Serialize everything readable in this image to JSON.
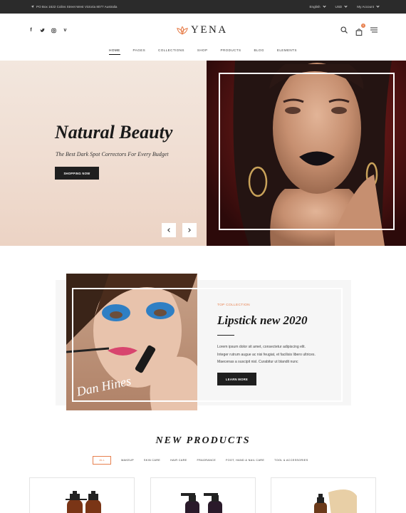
{
  "topbar": {
    "address": "PO Box 1622 Colins Street West Victoria 8077 Australia",
    "language": "English",
    "currency": "USD",
    "account": "My Account"
  },
  "header": {
    "logo": "YENA",
    "nav": [
      "HOME",
      "PAGES",
      "COLLECTIONS",
      "SHOP",
      "PRODUCTS",
      "BLOG",
      "ELEMENTS"
    ],
    "cart_count": "0"
  },
  "hero": {
    "title": "Natural Beauty",
    "subtitle": "The Best Dark Spot Correctors For Every Budget",
    "button": "SHOPPING NOW"
  },
  "collection": {
    "tag": "TOP COLLECTION",
    "title": "Lipstick new 2020",
    "lines": [
      "Lorem ipsum dolor sit amet, consectetur adipiscing elit.",
      "Integer rutrum augue ac nisi feugiat, et facilisis libero ultrices.",
      "Maecenas a suscipit nisl. Curabitur ut blandit nunc"
    ],
    "button": "LEARN MORE",
    "signature": "Dan Hines"
  },
  "new_products": {
    "title": "NEW PRODUCTS",
    "tabs": [
      "ALL",
      "MAKEUP",
      "SKIN CARE",
      "HAIR CARE",
      "FRAGRANCE",
      "FOOT, HAND & NAIL CARE",
      "TOOL & ACCESSORIES"
    ]
  },
  "colors": {
    "accent": "#e7804e",
    "dark": "#1f1f1f",
    "topbar": "#2b2b2b"
  }
}
